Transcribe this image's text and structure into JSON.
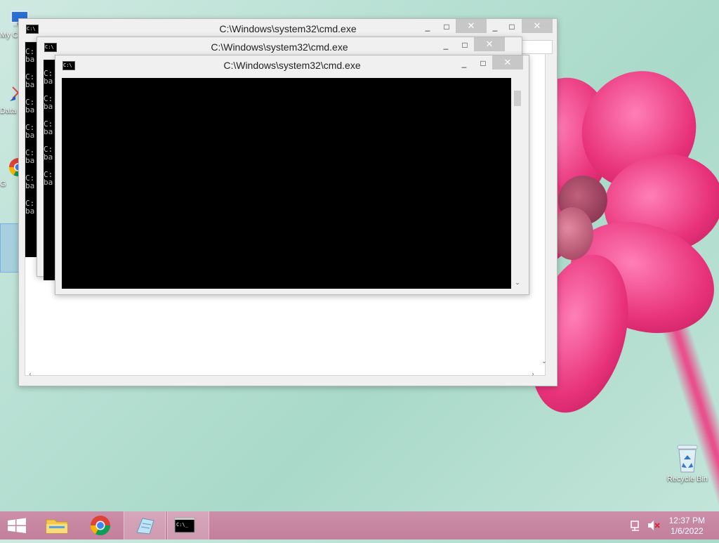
{
  "desktop": {
    "icons": [
      {
        "name": "my-computer",
        "label": "My C"
      },
      {
        "name": "data",
        "label": "Data"
      },
      {
        "name": "google-chrome",
        "label": "G"
      }
    ],
    "recycle_bin_label": "Recycle Bin"
  },
  "windows": [
    {
      "title": "C:\\Windows\\system32\\cmd.exe",
      "console_lines": [
        "C:",
        "ba",
        "C:",
        "ba",
        "C:",
        "ba",
        "C:",
        "ba",
        "C:",
        "ba",
        "C:",
        "ba",
        "C:",
        "ba"
      ]
    },
    {
      "title": "C:\\Windows\\system32\\cmd.exe",
      "console_lines": [
        "C:",
        "ba",
        "C:",
        "ba",
        "C:",
        "ba",
        "C:",
        "ba",
        "C:",
        "ba"
      ]
    },
    {
      "title": "C:\\Windows\\system32\\cmd.exe",
      "console_lines": []
    }
  ],
  "controls": {
    "minimize": "_",
    "maximize": "□",
    "close": "✕"
  },
  "taskbar": {
    "items": [
      {
        "name": "file-explorer",
        "icon": "folder-icon"
      },
      {
        "name": "google-chrome",
        "icon": "chrome-icon"
      },
      {
        "name": "notepad",
        "icon": "notepad-icon"
      },
      {
        "name": "command-prompt",
        "icon": "cmd-icon"
      }
    ],
    "clock_time": "12:37 PM",
    "clock_date": "1/6/2022"
  },
  "colors": {
    "taskbar": "#c98aa4",
    "close_button": "#c7c7c7",
    "console_bg": "#000000"
  }
}
